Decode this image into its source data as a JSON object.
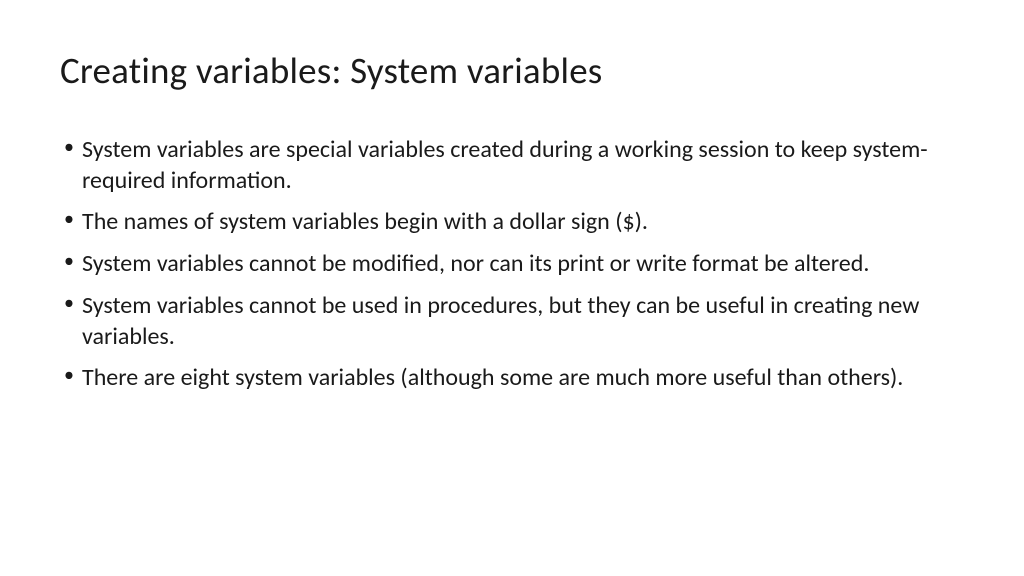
{
  "slide": {
    "title": "Creating variables: System variables",
    "bullets": [
      "System variables are special variables created during a working session to keep system-required information.",
      "The names of system variables begin with a dollar sign ($).",
      "System variables cannot be modified, nor can its print or write format be altered.",
      "System variables cannot be used in procedures, but they can be useful in creating new variables.",
      "There are eight system variables (although some are much more useful than others)."
    ]
  }
}
